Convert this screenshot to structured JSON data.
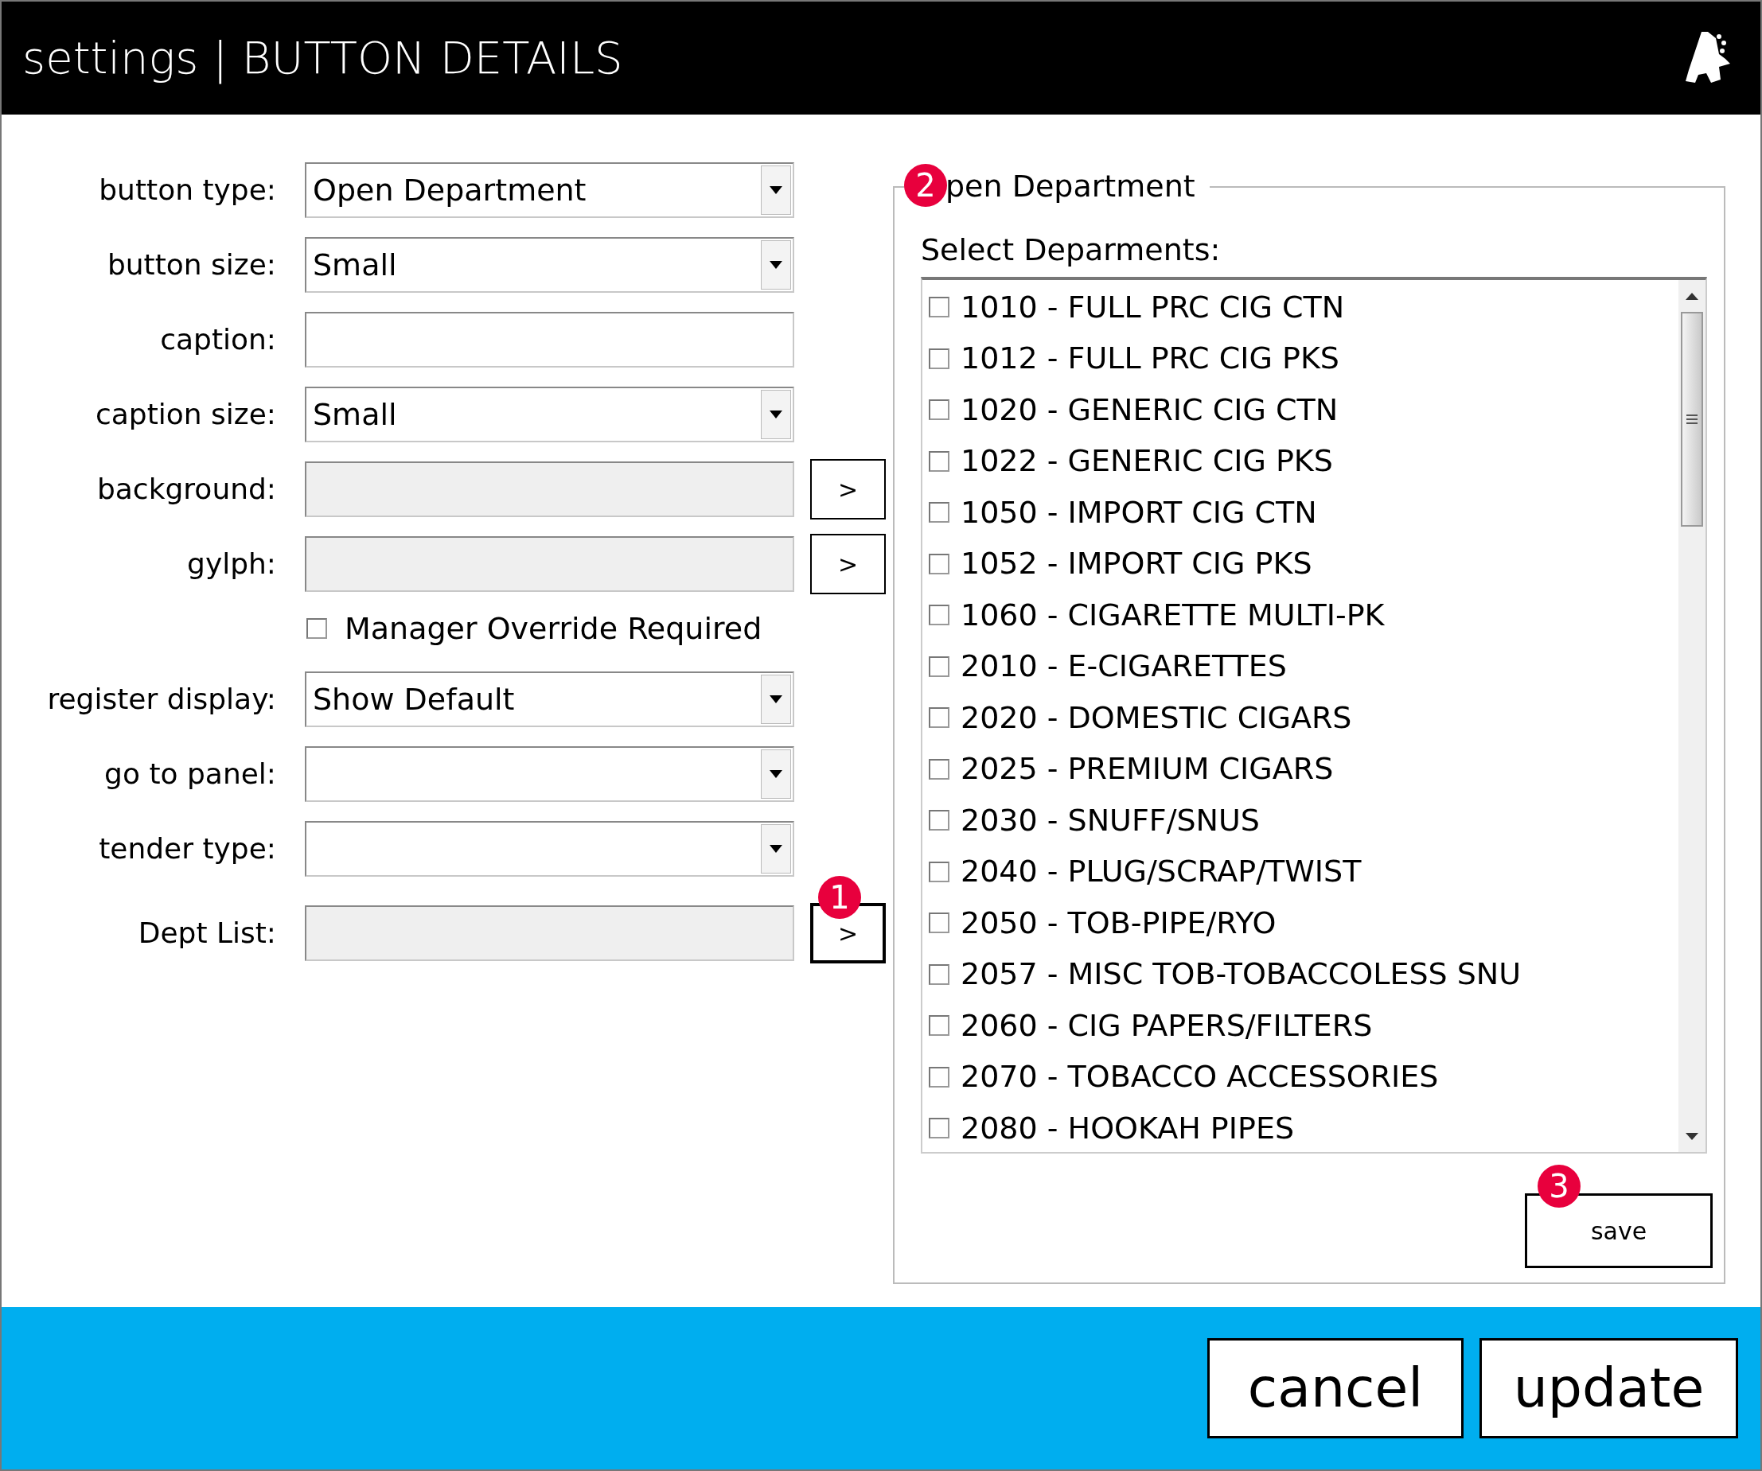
{
  "header": {
    "title": "settings | BUTTON DETAILS"
  },
  "form": [
    {
      "kind": "select",
      "label": "button type:",
      "value": "Open Department"
    },
    {
      "kind": "select",
      "label": "button size:",
      "value": "Small"
    },
    {
      "kind": "text",
      "label": "caption:"
    },
    {
      "kind": "select",
      "label": "caption size:",
      "value": "Small"
    },
    {
      "kind": "picker",
      "label": "background:",
      "button": ">"
    },
    {
      "kind": "picker",
      "label": "gylph:",
      "button": ">"
    },
    {
      "kind": "checkbox",
      "label": "Manager Override Required",
      "checked": false
    },
    {
      "kind": "select",
      "label": "register display:",
      "value": "Show Default"
    },
    {
      "kind": "select",
      "label": "go to panel:"
    },
    {
      "kind": "select",
      "label": "tender type:"
    },
    {
      "kind": "picker",
      "label": "Dept List:",
      "button": ">",
      "marker": "1"
    }
  ],
  "group": {
    "title": "pen Department",
    "marker": "2",
    "list_label": "Select Deparments:",
    "departments": [
      {
        "label": "1010 - FULL PRC CIG CTN",
        "checked": false
      },
      {
        "label": "1012 - FULL PRC CIG PKS",
        "checked": false
      },
      {
        "label": "1020 - GENERIC CIG CTN",
        "checked": false
      },
      {
        "label": "1022 - GENERIC CIG PKS",
        "checked": false
      },
      {
        "label": "1050 - IMPORT CIG CTN",
        "checked": false
      },
      {
        "label": "1052 - IMPORT CIG PKS",
        "checked": false
      },
      {
        "label": "1060 - CIGARETTE MULTI-PK",
        "checked": false
      },
      {
        "label": "2010 - E-CIGARETTES",
        "checked": false
      },
      {
        "label": "2020 - DOMESTIC CIGARS",
        "checked": false
      },
      {
        "label": "2025 - PREMIUM CIGARS",
        "checked": false
      },
      {
        "label": "2030 - SNUFF/SNUS",
        "checked": false
      },
      {
        "label": "2040 - PLUG/SCRAP/TWIST",
        "checked": false
      },
      {
        "label": "2050 - TOB-PIPE/RYO",
        "checked": false
      },
      {
        "label": "2057 - MISC TOB-TOBACCOLESS SNU",
        "checked": false
      },
      {
        "label": "2060 - CIG PAPERS/FILTERS",
        "checked": false
      },
      {
        "label": "2070 - TOBACCO ACCESSORIES",
        "checked": false
      },
      {
        "label": "2080 - HOOKAH PIPES",
        "checked": false
      }
    ],
    "save": "save",
    "save_marker": "3"
  },
  "footer": {
    "buttons": [
      "cancel",
      "update"
    ]
  }
}
